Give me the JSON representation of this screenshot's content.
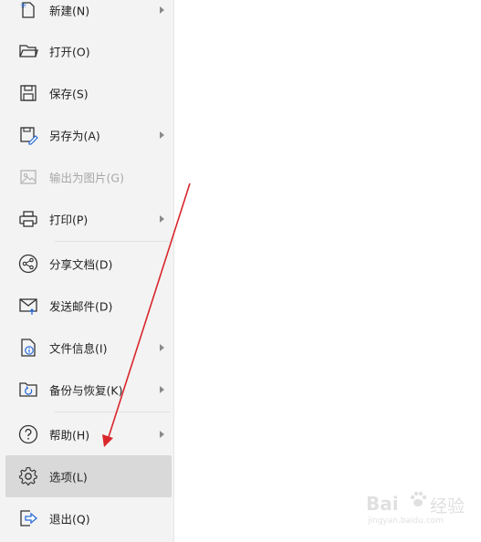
{
  "menu": {
    "items": [
      {
        "id": "new",
        "label": "新建(N)",
        "icon": "new-file-icon",
        "has_submenu": true
      },
      {
        "id": "open",
        "label": "打开(O)",
        "icon": "folder-open-icon",
        "has_submenu": false
      },
      {
        "id": "save",
        "label": "保存(S)",
        "icon": "save-icon",
        "has_submenu": false
      },
      {
        "id": "save-as",
        "label": "另存为(A)",
        "icon": "save-as-icon",
        "has_submenu": true
      },
      {
        "id": "export-image",
        "label": "输出为图片(G)",
        "icon": "image-icon",
        "has_submenu": false,
        "disabled": true
      },
      {
        "id": "print",
        "label": "打印(P)",
        "icon": "printer-icon",
        "has_submenu": true
      },
      {
        "id": "share",
        "label": "分享文档(D)",
        "icon": "share-icon",
        "has_submenu": false
      },
      {
        "id": "send-mail",
        "label": "发送邮件(D)",
        "icon": "mail-icon",
        "has_submenu": false
      },
      {
        "id": "file-info",
        "label": "文件信息(I)",
        "icon": "file-info-icon",
        "has_submenu": true
      },
      {
        "id": "backup",
        "label": "备份与恢复(K)",
        "icon": "backup-restore-icon",
        "has_submenu": true
      },
      {
        "id": "help",
        "label": "帮助(H)",
        "icon": "help-icon",
        "has_submenu": true
      },
      {
        "id": "options",
        "label": "选项(L)",
        "icon": "gear-icon",
        "has_submenu": false,
        "selected": true
      },
      {
        "id": "exit",
        "label": "退出(Q)",
        "icon": "exit-icon",
        "has_submenu": false
      }
    ]
  },
  "annotation": {
    "arrow_color": "#d9262b"
  },
  "watermark": {
    "logo": "Bai",
    "logo_suffix": "经验",
    "url": "jingyan.baidu.com"
  }
}
